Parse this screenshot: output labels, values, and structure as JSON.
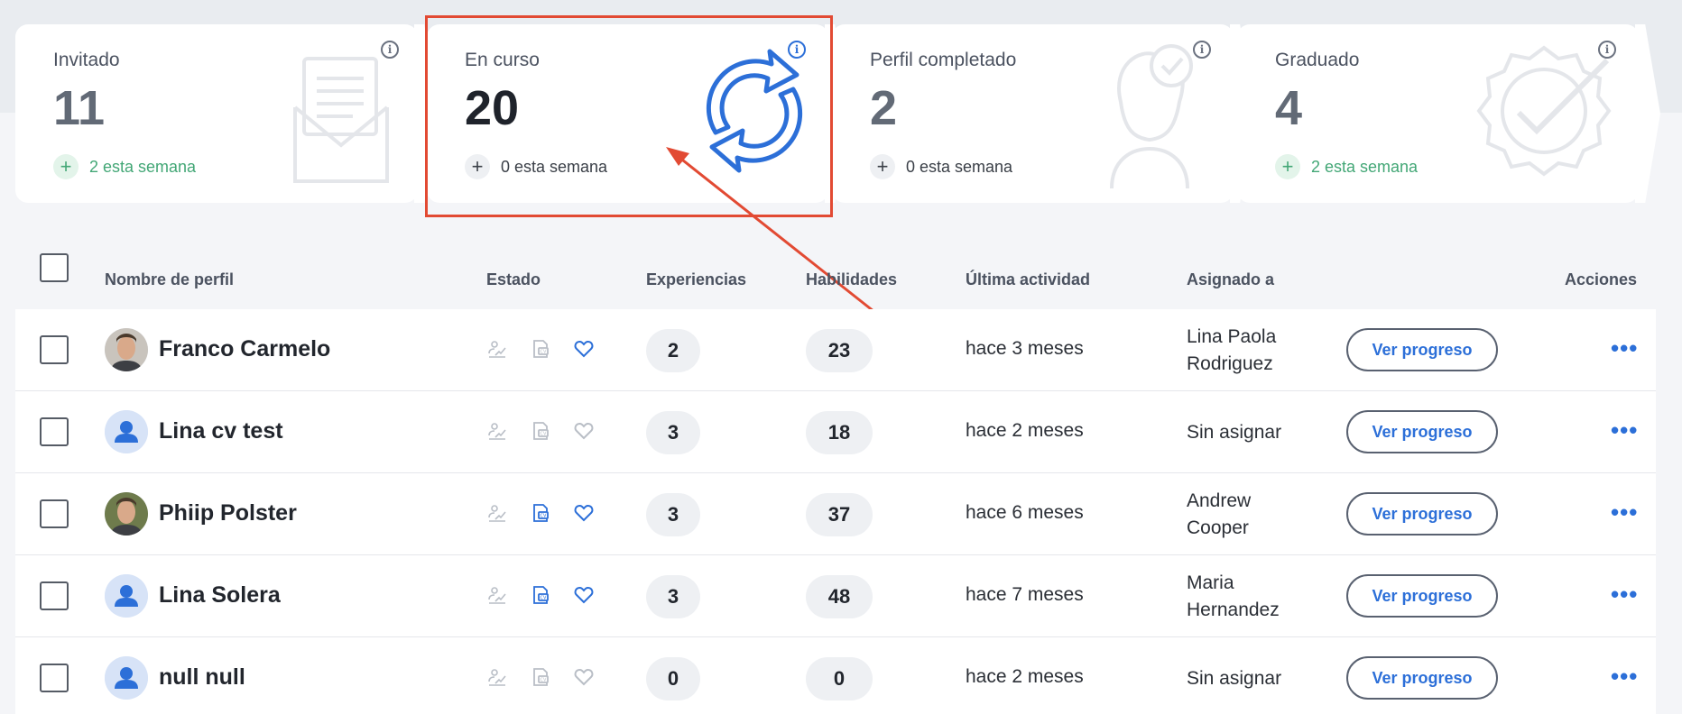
{
  "pipeline": [
    {
      "label": "Invitado",
      "count": "11",
      "week": "2 esta semana",
      "week_style": "green",
      "icon": "envelope-icon"
    },
    {
      "label": "En curso",
      "count": "20",
      "week": "0 esta semana",
      "week_style": "neutral",
      "icon": "refresh-icon"
    },
    {
      "label": "Perfil completado",
      "count": "2",
      "week": "0 esta semana",
      "week_style": "neutral",
      "icon": "profile-check-icon"
    },
    {
      "label": "Graduado",
      "count": "4",
      "week": "2 esta semana",
      "week_style": "green",
      "icon": "seal-check-icon"
    }
  ],
  "table": {
    "headers": {
      "name": "Nombre de perfil",
      "state": "Estado",
      "experiences": "Experiencias",
      "skills": "Habilidades",
      "last_activity": "Última actividad",
      "assigned": "Asignado a",
      "actions": "Acciones"
    },
    "rows": [
      {
        "name": "Franco Carmelo",
        "avatar": "photo-man-1",
        "experiences": "2",
        "skills": "23",
        "activity": "hace 3 meses",
        "assigned_line1": "Lina Paola",
        "assigned_line2": "Rodriguez",
        "cv_active": false,
        "fav_active": true
      },
      {
        "name": "Lina cv test",
        "avatar": "default",
        "experiences": "3",
        "skills": "18",
        "activity": "hace 2 meses",
        "assigned_line1": "Sin asignar",
        "assigned_line2": "",
        "cv_active": false,
        "fav_active": false
      },
      {
        "name": "Phiip Polster",
        "avatar": "photo-man-2",
        "experiences": "3",
        "skills": "37",
        "activity": "hace 6 meses",
        "assigned_line1": "Andrew",
        "assigned_line2": "Cooper",
        "cv_active": true,
        "fav_active": true
      },
      {
        "name": "Lina Solera",
        "avatar": "default",
        "experiences": "3",
        "skills": "48",
        "activity": "hace 7 meses",
        "assigned_line1": "Maria",
        "assigned_line2": "Hernandez",
        "cv_active": true,
        "fav_active": true
      },
      {
        "name": "null null",
        "avatar": "default",
        "experiences": "0",
        "skills": "0",
        "activity": "hace 2 meses",
        "assigned_line1": "Sin asignar",
        "assigned_line2": "",
        "cv_active": false,
        "fav_active": false
      }
    ],
    "progress_label": "Ver progreso",
    "more_label": "•••"
  },
  "colors": {
    "accent": "#2c6fd8",
    "highlight": "#e24a33",
    "green": "#43a776",
    "muted_icon": "#b9bec6"
  }
}
